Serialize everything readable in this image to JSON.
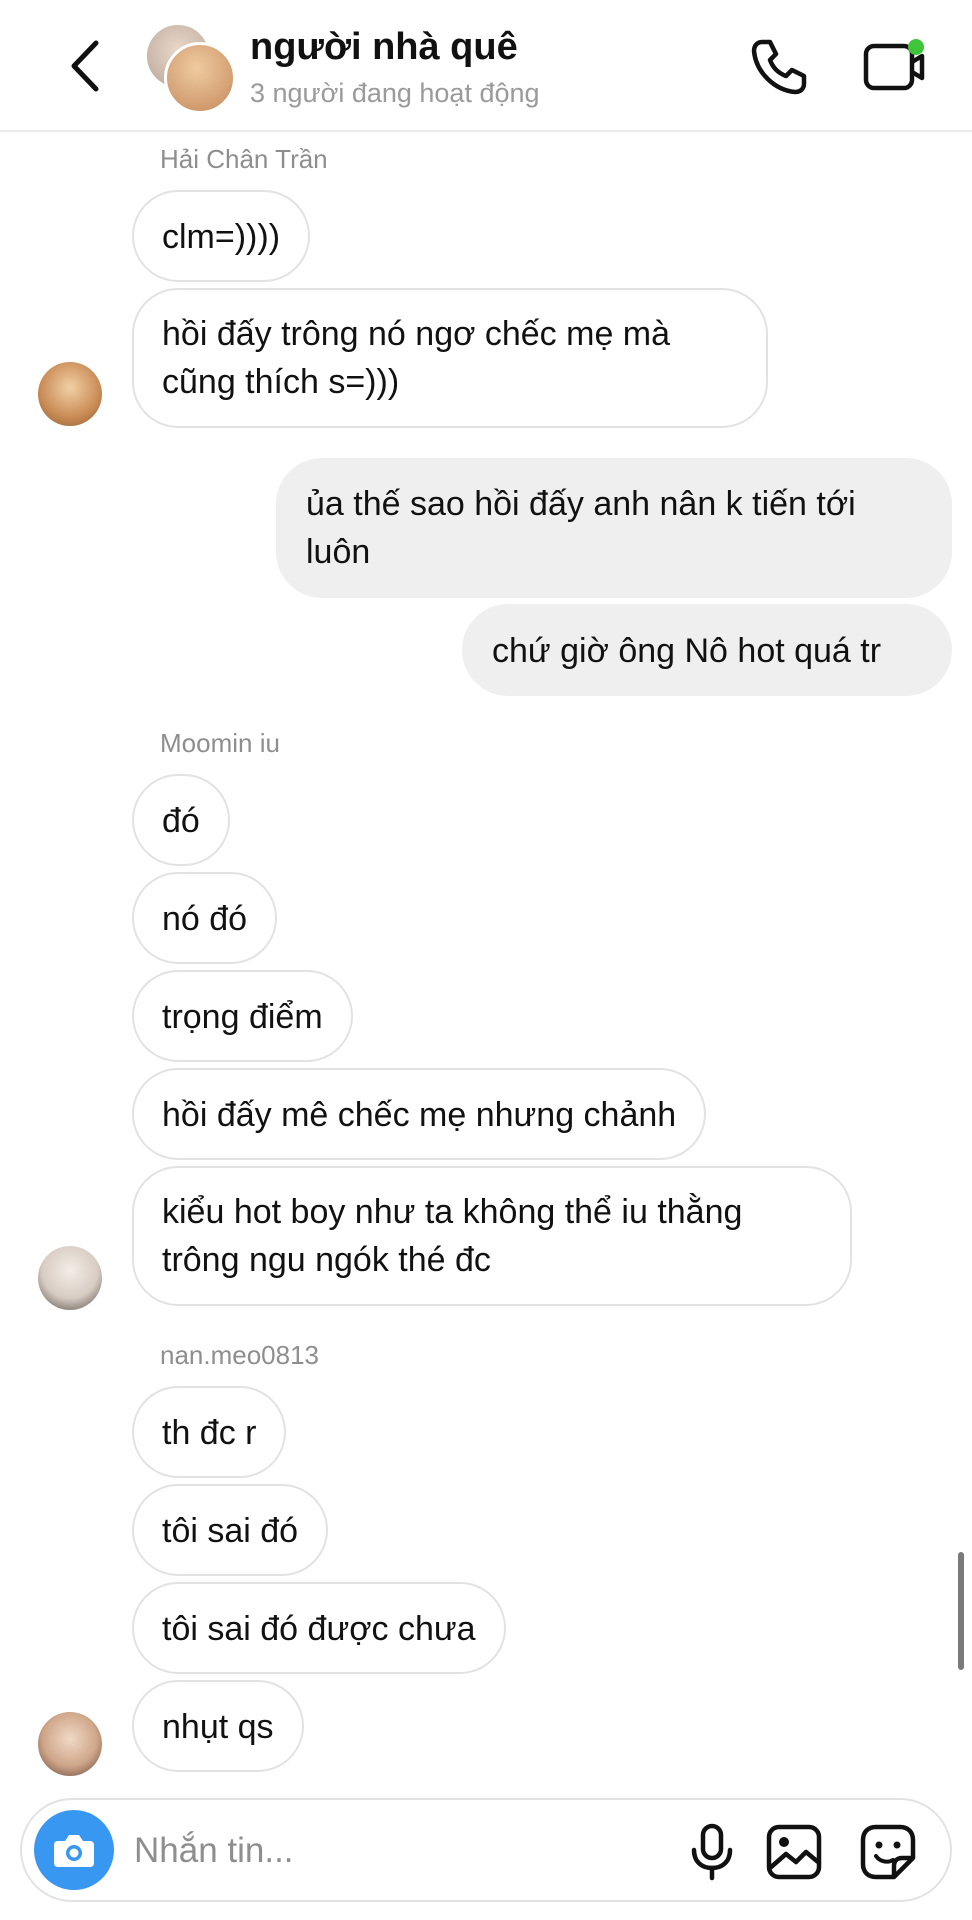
{
  "header": {
    "title": "người nhà quê",
    "subtitle": "3 người đang hoạt động"
  },
  "icons": {
    "back": "chevron-left-icon",
    "call": "phone-icon",
    "video": "video-camera-icon",
    "camera": "camera-icon",
    "mic": "microphone-icon",
    "gallery": "image-icon",
    "sticker": "sticker-icon"
  },
  "colors": {
    "online_dot": "#3fc53a",
    "camera_button": "#3897f0",
    "outgoing_bubble": "#efefef"
  },
  "messages": {
    "group1": {
      "sender": "Hải Chân Trần",
      "m1": "clm=))))",
      "m2": "hồi đấy trông nó ngơ chếc mẹ mà cũng thích s=)))"
    },
    "outgoing": {
      "m1": "ủa thế sao hồi đấy anh nân k tiến tới luôn",
      "m2": "chứ giờ ông Nô hot quá tr"
    },
    "group2": {
      "sender": "Moomin iu",
      "m1": "đó",
      "m2": "nó đó",
      "m3": "trọng điểm",
      "m4": "hồi đấy mê chếc mẹ nhưng chảnh",
      "m5": "kiểu hot boy như ta không thể iu thằng trông ngu ngók thé đc"
    },
    "group3": {
      "sender": "nan.meo0813",
      "m1": "th đc r",
      "m2": "tôi sai đó",
      "m3": "tôi sai đó được chưa",
      "m4": "nhụt qs"
    }
  },
  "composer": {
    "placeholder": "Nhắn tin..."
  }
}
